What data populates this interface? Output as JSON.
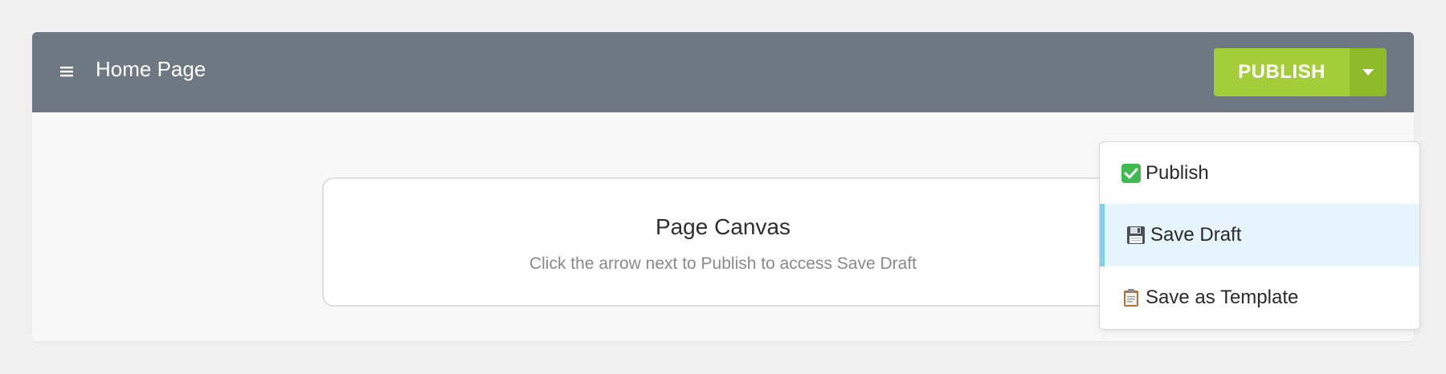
{
  "header": {
    "title": "Home Page",
    "menu_icon": "hamburger-menu-icon"
  },
  "publish": {
    "label": "PUBLISH",
    "dropdown_icon": "caret-down-icon",
    "colors": {
      "primary": "#a3cd39",
      "arrow": "#8fbb2a"
    }
  },
  "canvas": {
    "title": "Page Canvas",
    "hint": "Click the arrow next to Publish to access Save Draft"
  },
  "dropdown": {
    "items": [
      {
        "label": "Publish",
        "icon": "check-mark-icon",
        "active": false
      },
      {
        "label": "Save Draft",
        "icon": "floppy-disk-icon",
        "active": true
      },
      {
        "label": "Save as Template",
        "icon": "clipboard-icon",
        "active": false
      }
    ],
    "active_color": "#7cd0f0"
  }
}
